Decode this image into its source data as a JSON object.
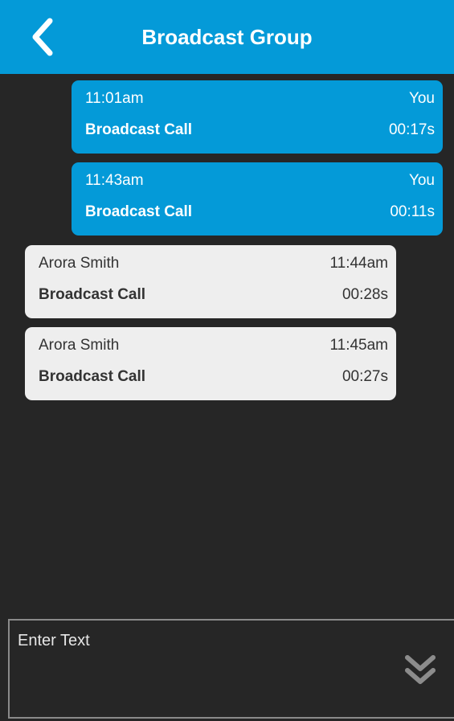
{
  "header": {
    "title": "Broadcast Group",
    "back_icon": "chevron-left-icon",
    "background": "#049ad8"
  },
  "messages": [
    {
      "direction": "outgoing",
      "time": "11:01am",
      "sender": "You",
      "type": "Broadcast Call",
      "duration": "00:17s"
    },
    {
      "direction": "outgoing",
      "time": "11:43am",
      "sender": "You",
      "type": "Broadcast Call",
      "duration": "00:11s"
    },
    {
      "direction": "incoming",
      "sender": "Arora Smith",
      "time": "11:44am",
      "type": "Broadcast Call",
      "duration": "00:28s"
    },
    {
      "direction": "incoming",
      "sender": "Arora Smith",
      "time": "11:45am",
      "type": "Broadcast Call",
      "duration": "00:27s"
    }
  ],
  "composer": {
    "placeholder": "Enter Text",
    "value": "",
    "expand_icon": "double-chevron-down-icon"
  },
  "colors": {
    "accent": "#049ad8",
    "background": "#262626",
    "incoming_bubble": "#eeeeee"
  }
}
